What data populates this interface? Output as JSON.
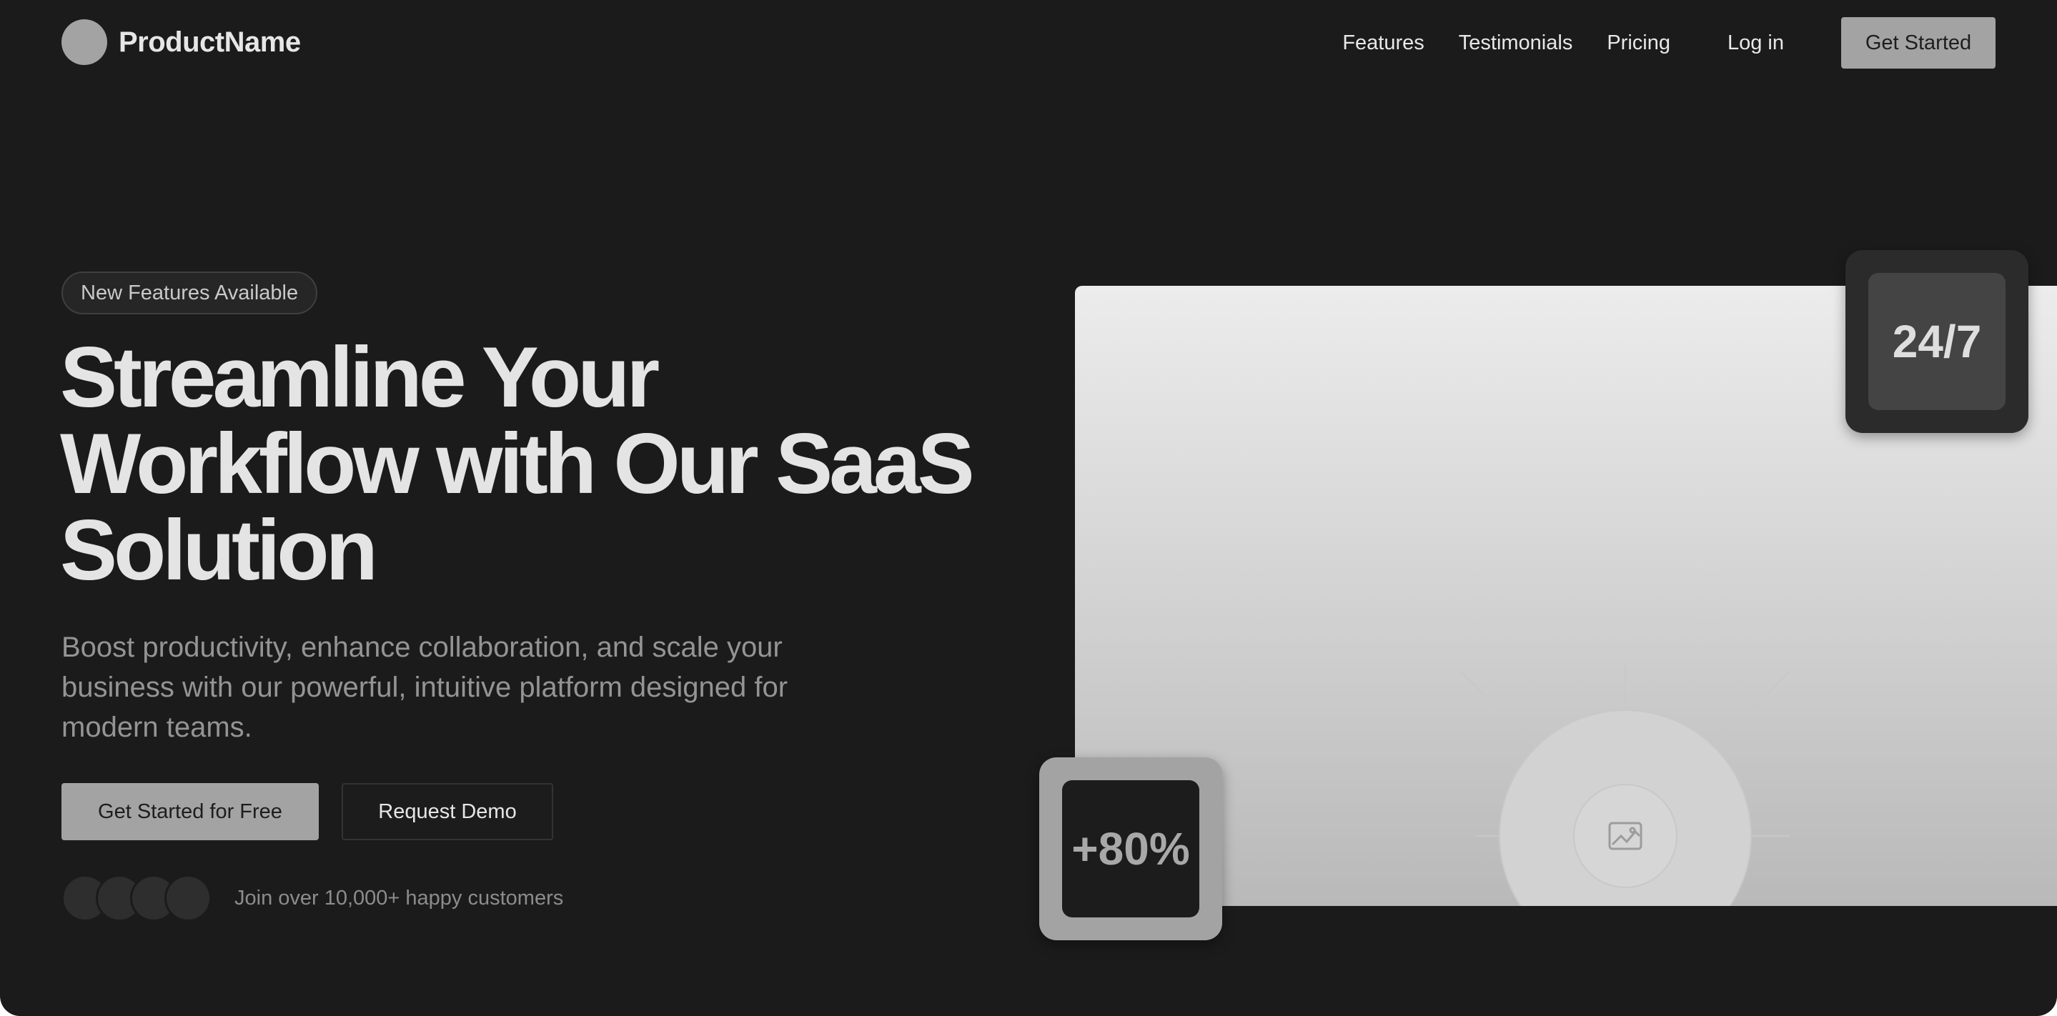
{
  "brand": {
    "name": "ProductName",
    "logo_color": "#a3a3a3"
  },
  "nav": {
    "links": [
      "Features",
      "Testimonials",
      "Pricing"
    ],
    "login": "Log in",
    "cta": "Get Started"
  },
  "hero": {
    "badge": "New Features Available",
    "headline_lines": [
      "Streamline Your",
      "Workflow with Our SaaS",
      "Solution"
    ],
    "subtext": "Boost productivity, enhance collaboration, and scale your business with our powerful, intuitive platform designed for modern teams.",
    "primary_button": "Get Started for Free",
    "secondary_button": "Request Demo",
    "social_proof": "Join over 10,000+ happy customers",
    "avatar_count": 4
  },
  "stats": {
    "top": "24/7",
    "bottom": "+80%"
  },
  "media": {
    "placeholder_icon": "image-icon"
  },
  "colors": {
    "background": "#1b1b1c",
    "accent": "#a3a3a3",
    "text": "#e4e4e4",
    "muted": "#949494"
  }
}
